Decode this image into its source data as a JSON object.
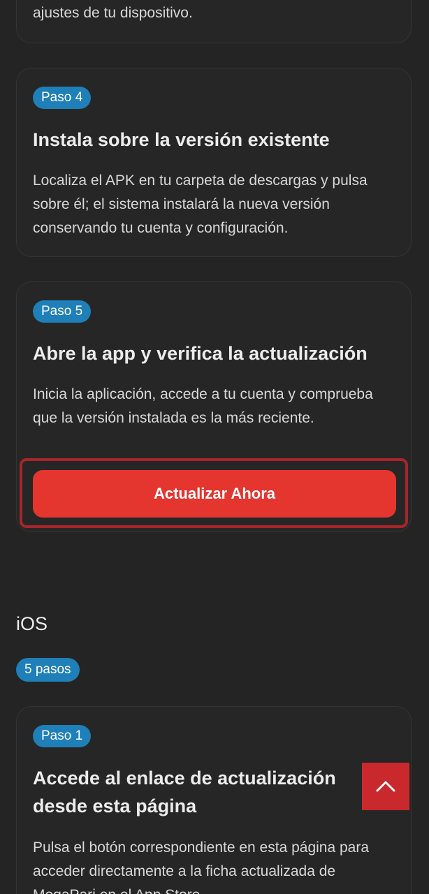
{
  "step3": {
    "desc_tail": "ajustes de tu dispositivo."
  },
  "step4": {
    "badge": "Paso 4",
    "title": "Instala sobre la versión existente",
    "desc": "Localiza el APK en tu carpeta de descargas y pulsa sobre él; el sistema instalará la nueva versión conservando tu cuenta y configuración."
  },
  "step5": {
    "badge": "Paso 5",
    "title": "Abre la app y verifica la actualización",
    "desc": "Inicia la aplicación, accede a tu cuenta y comprueba que la versión instalada es la más reciente.",
    "button_label": "Actualizar Ahora"
  },
  "ios": {
    "heading": "iOS",
    "steps_badge": "5 pasos",
    "step1": {
      "badge": "Paso 1",
      "title": "Accede al enlace de actualización desde esta página",
      "desc": "Pulsa el botón correspondiente en esta página para acceder directamente a la ficha actualizada de MegaPari en el App Store."
    }
  },
  "icons": {
    "scroll_top": "chevron-up-icon"
  },
  "colors": {
    "background": "#242424",
    "badge": "#1f7fb8",
    "accent": "#e4352f",
    "highlight_frame": "#a8252a",
    "scroll_top": "#c9292c"
  }
}
